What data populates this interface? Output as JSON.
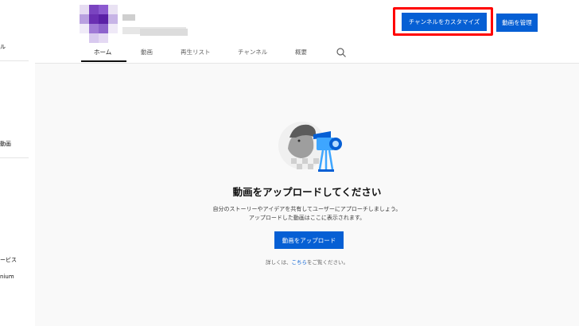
{
  "sidebar": {
    "items": [
      {
        "label": "ル"
      },
      {
        "label": "動画"
      },
      {
        "label": "ービス"
      },
      {
        "label": "nium"
      }
    ]
  },
  "channel": {
    "avatar_colors": [
      "#e6dcf2",
      "#7a44c0",
      "#8c5ad0",
      "#e9e2f3",
      "#b9a0e0",
      "#6a2fb2",
      "#5a20a6",
      "#c7b4e6",
      "#f0ebf8",
      "#a07ad6",
      "#8d63cc",
      "#efe9f7",
      "#ffffff",
      "#d8c9ef",
      "#e4d9f3",
      "#ffffff"
    ]
  },
  "header": {
    "customize_button": "チャンネルをカスタマイズ",
    "manage_button": "動画を管理",
    "highlight_color": "#ff0000",
    "accent_color": "#065fd4"
  },
  "tabs": [
    {
      "label": "ホーム"
    },
    {
      "label": "動画"
    },
    {
      "label": "再生リスト"
    },
    {
      "label": "チャンネル"
    },
    {
      "label": "概要"
    }
  ],
  "main": {
    "title": "動画をアップロードしてください",
    "description_line1": "自分のストーリーやアイデアを共有してユーザーにアプローチしましょう。",
    "description_line2": "アップロードした動画はここに表示されます。",
    "upload_button": "動画をアップロード",
    "help_prefix": "詳しくは、",
    "help_link": "こちら",
    "help_suffix": "をご覧ください。"
  }
}
